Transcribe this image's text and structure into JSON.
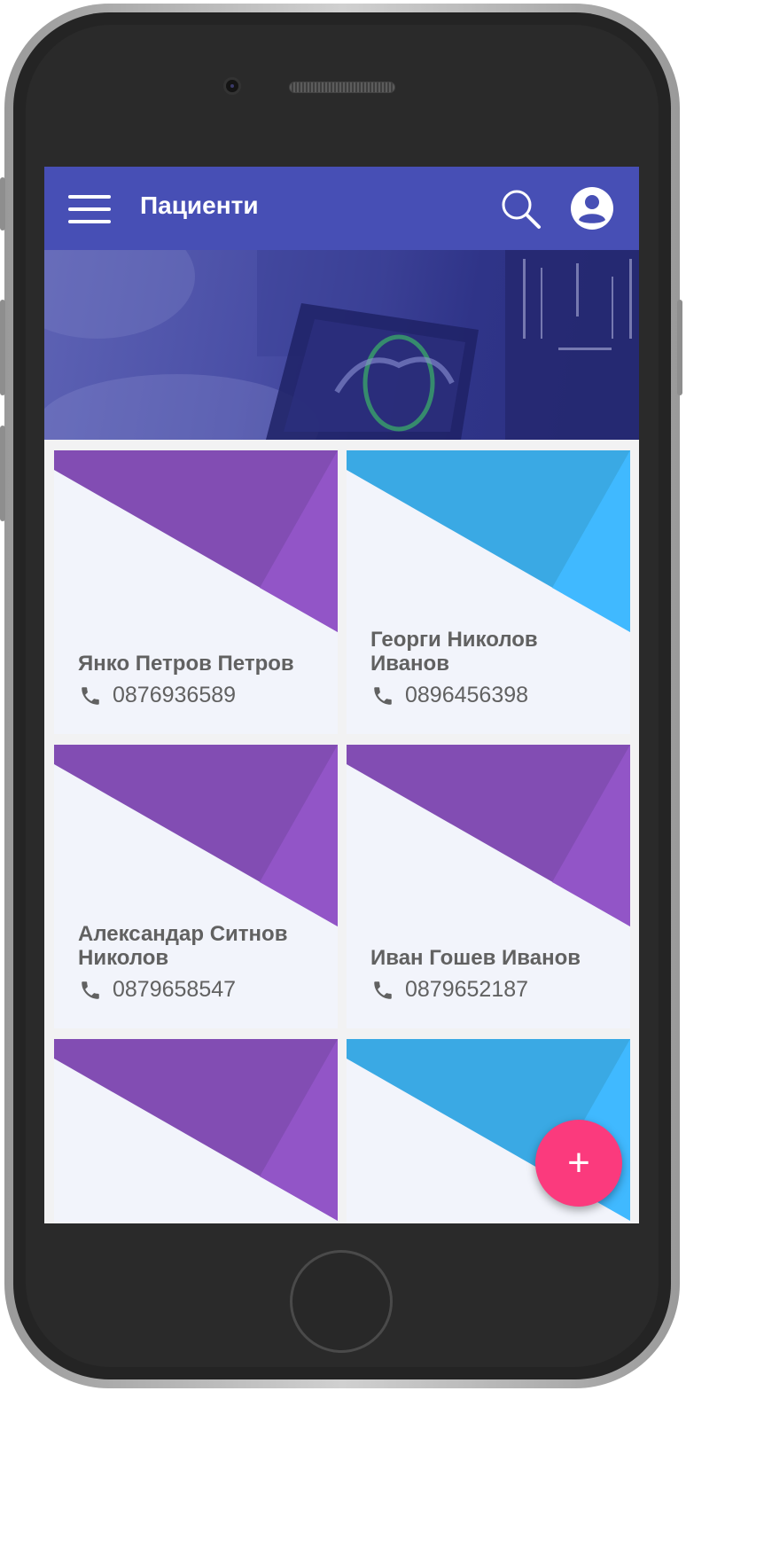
{
  "app": {
    "title": "Пациенти",
    "accent_color": "#474fb5",
    "fab_color": "#fb3a7d",
    "fab_label": "+"
  },
  "toolbar": {
    "menu_icon": "hamburger-menu-icon",
    "search_icon": "search-icon",
    "profile_icon": "account-circle-icon"
  },
  "patients": [
    {
      "name": "Янко Петров Петров",
      "phone": "0876936589",
      "theme": "purple"
    },
    {
      "name": "Георги Николов Иванов",
      "phone": "0896456398",
      "theme": "blue"
    },
    {
      "name": "Александар Ситнов Николов",
      "phone": "0879658547",
      "theme": "purple"
    },
    {
      "name": "Иван Гошев Иванов",
      "phone": "0879652187",
      "theme": "purple"
    },
    {
      "name": "",
      "phone": "",
      "theme": "purple"
    },
    {
      "name": "",
      "phone": "",
      "theme": "blue"
    }
  ],
  "themes": {
    "purple": {
      "main": "#824db3",
      "accent": "#9255c7"
    },
    "blue": {
      "main": "#3aa9e4",
      "accent": "#40b9ff"
    }
  }
}
